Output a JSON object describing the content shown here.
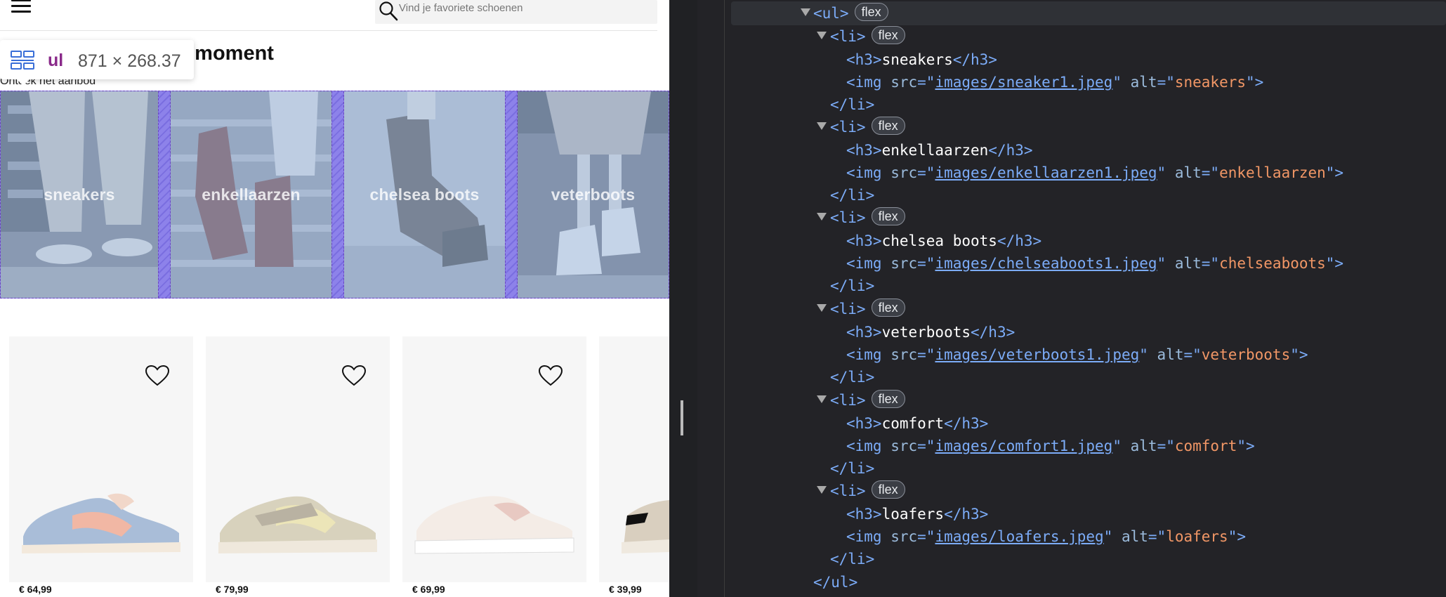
{
  "site": {
    "search_placeholder": "Vind je favoriete schoenen",
    "heading": "Categorieën van dit moment",
    "subheading": "Ontdek het aanbod",
    "inspector": {
      "tag": "ul",
      "dimensions": "871 × 268.37"
    },
    "categories": [
      {
        "label": "sneakers"
      },
      {
        "label": "enkellaarzen"
      },
      {
        "label": "chelsea boots"
      },
      {
        "label": "veterboots"
      }
    ],
    "products": [
      {
        "price": "€ 64,99"
      },
      {
        "price": "€ 79,99"
      },
      {
        "price": "€ 69,99"
      },
      {
        "price": "€ 39,99"
      }
    ]
  },
  "devtools": {
    "ul_open": "<ul>",
    "ul_close": "</ul>",
    "badge": "flex",
    "li_open": "<li>",
    "li_close": "</li>",
    "items": [
      {
        "h3": "sneakers",
        "src": "images/sneaker1.jpeg",
        "alt": "sneakers"
      },
      {
        "h3": "enkellaarzen",
        "src": "images/enkellaarzen1.jpeg",
        "alt": "enkellaarzen"
      },
      {
        "h3": "chelsea boots",
        "src": "images/chelseaboots1.jpeg",
        "alt": "chelseaboots"
      },
      {
        "h3": "veterboots",
        "src": "images/veterboots1.jpeg",
        "alt": "veterboots"
      },
      {
        "h3": "comfort",
        "src": "images/comfort1.jpeg",
        "alt": "comfort"
      },
      {
        "h3": "loafers",
        "src": "images/loafers.jpeg",
        "alt": "loafers"
      }
    ]
  },
  "colors": {
    "inspector_overlay": "#8b82e6",
    "tag_color": "#7cacf8",
    "attr_value_color": "#f29766",
    "devtools_bg": "#232327"
  }
}
